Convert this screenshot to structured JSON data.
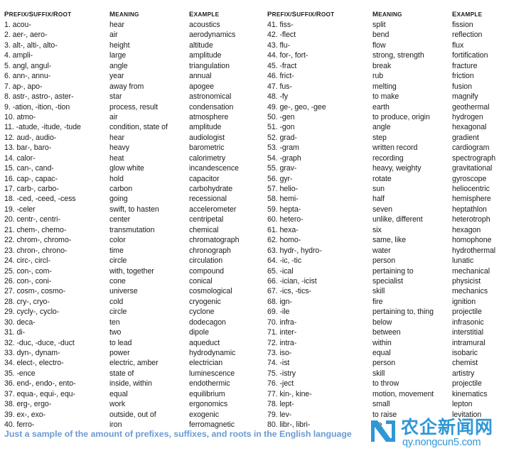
{
  "document": {
    "caption": "Just a sample of the amount of prefixes, suffixes, and roots in the English language",
    "caption_color": "#6b9bd2"
  },
  "columns": {
    "term": "Prefix/Suffix/Root",
    "meaning": "Meaning",
    "example": "Example"
  },
  "watermark": {
    "logo_text": "ND",
    "chinese_text": "农企新闻网",
    "url": "qy.nongcun5.com",
    "color": "#2f97d6"
  },
  "left_column": [
    {
      "n": "1.",
      "term": "acou-",
      "meaning": "hear",
      "example": "acoustics"
    },
    {
      "n": "2.",
      "term": "aer-, aero-",
      "meaning": "air",
      "example": "aerodynamics"
    },
    {
      "n": "3.",
      "term": "alt-, alti-, alto-",
      "meaning": "height",
      "example": "altitude"
    },
    {
      "n": "4.",
      "term": "ampli-",
      "meaning": "large",
      "example": "amplitude"
    },
    {
      "n": "5.",
      "term": "angl, angul-",
      "meaning": "angle",
      "example": "triangulation"
    },
    {
      "n": "6.",
      "term": "ann-, annu-",
      "meaning": "year",
      "example": "annual"
    },
    {
      "n": "7.",
      "term": "ap-, apo-",
      "meaning": "away from",
      "example": "apogee"
    },
    {
      "n": "8.",
      "term": "astr-, astro-, aster-",
      "meaning": "star",
      "example": "astronomical"
    },
    {
      "n": "9.",
      "term": "-ation, -ition, -tion",
      "meaning": "process, result",
      "example": "condensation"
    },
    {
      "n": "10.",
      "term": "atmo-",
      "meaning": "air",
      "example": "atmosphere"
    },
    {
      "n": "11.",
      "term": "-atude, -itude, -tude",
      "meaning": "condition, state of",
      "example": "amplitude"
    },
    {
      "n": "12.",
      "term": "aud-, audio-",
      "meaning": "hear",
      "example": "audiologist"
    },
    {
      "n": "13.",
      "term": "bar-, baro-",
      "meaning": "heavy",
      "example": "barometric"
    },
    {
      "n": "14.",
      "term": "calor-",
      "meaning": "heat",
      "example": "calorimetry"
    },
    {
      "n": "15.",
      "term": "can-, cand-",
      "meaning": "glow white",
      "example": "incandescence"
    },
    {
      "n": "16.",
      "term": "cap-, capac-",
      "meaning": "hold",
      "example": "capacitor"
    },
    {
      "n": "17.",
      "term": "carb-, carbo-",
      "meaning": "carbon",
      "example": "carbohydrate"
    },
    {
      "n": "18.",
      "term": "-ced, -ceed, -cess",
      "meaning": "going",
      "example": "recessional"
    },
    {
      "n": "19.",
      "term": "-celer",
      "meaning": "swift, to hasten",
      "example": "accelerometer"
    },
    {
      "n": "20.",
      "term": "centr-, centri-",
      "meaning": "center",
      "example": "centripetal"
    },
    {
      "n": "21.",
      "term": "chem-, chemo-",
      "meaning": "transmutation",
      "example": "chemical"
    },
    {
      "n": "22.",
      "term": "chrom-, chromo-",
      "meaning": "color",
      "example": "chromatograph"
    },
    {
      "n": "23.",
      "term": "chron-, chrono-",
      "meaning": "time",
      "example": "chronograph"
    },
    {
      "n": "24.",
      "term": "circ-, circl-",
      "meaning": "circle",
      "example": "circulation"
    },
    {
      "n": "25.",
      "term": "con-, com-",
      "meaning": "with, together",
      "example": "compound"
    },
    {
      "n": "26.",
      "term": "con-, coni-",
      "meaning": "cone",
      "example": "conical"
    },
    {
      "n": "27.",
      "term": "cosm-, cosmo-",
      "meaning": "universe",
      "example": "cosmological"
    },
    {
      "n": "28.",
      "term": "cry-, cryo-",
      "meaning": "cold",
      "example": "cryogenic"
    },
    {
      "n": "29.",
      "term": "cycly-, cyclo-",
      "meaning": "circle",
      "example": "cyclone"
    },
    {
      "n": "30.",
      "term": "deca-",
      "meaning": "ten",
      "example": "dodecagon"
    },
    {
      "n": "31.",
      "term": "di-",
      "meaning": "two",
      "example": "dipole"
    },
    {
      "n": "32.",
      "term": "-duc, -duce, -duct",
      "meaning": "to lead",
      "example": "aqueduct"
    },
    {
      "n": "33.",
      "term": "dyn-, dynam-",
      "meaning": "power",
      "example": "hydrodynamic"
    },
    {
      "n": "34.",
      "term": "elect-, electro-",
      "meaning": "electric, amber",
      "example": "electrician"
    },
    {
      "n": "35.",
      "term": "-ence",
      "meaning": "state of",
      "example": "luminescence"
    },
    {
      "n": "36.",
      "term": "end-, endo-, ento-",
      "meaning": "inside, within",
      "example": "endothermic"
    },
    {
      "n": "37.",
      "term": "equa-, equi-, equ-",
      "meaning": "equal",
      "example": "equilibrium"
    },
    {
      "n": "38.",
      "term": "erg-, ergo-",
      "meaning": "work",
      "example": "ergonomics"
    },
    {
      "n": "39.",
      "term": "ex-, exo-",
      "meaning": "outside, out of",
      "example": "exogenic"
    },
    {
      "n": "40.",
      "term": "ferro-",
      "meaning": "iron",
      "example": "ferromagnetic"
    }
  ],
  "right_column": [
    {
      "n": "41.",
      "term": "fiss-",
      "meaning": "split",
      "example": "fission"
    },
    {
      "n": "42.",
      "term": "-flect",
      "meaning": "bend",
      "example": "reflection"
    },
    {
      "n": "43.",
      "term": "flu-",
      "meaning": "flow",
      "example": "flux"
    },
    {
      "n": "44.",
      "term": "for-, fort-",
      "meaning": "strong, strength",
      "example": "fortification"
    },
    {
      "n": "45.",
      "term": "-fract",
      "meaning": "break",
      "example": "fracture"
    },
    {
      "n": "46.",
      "term": "frict-",
      "meaning": "rub",
      "example": "friction"
    },
    {
      "n": "47.",
      "term": "fus-",
      "meaning": "melting",
      "example": "fusion"
    },
    {
      "n": "48.",
      "term": "-fy",
      "meaning": "to make",
      "example": "magnify"
    },
    {
      "n": "49.",
      "term": "ge-, geo, -gee",
      "meaning": "earth",
      "example": "geothermal"
    },
    {
      "n": "50.",
      "term": "-gen",
      "meaning": "to produce, origin",
      "example": "hydrogen"
    },
    {
      "n": "51.",
      "term": "-gon",
      "meaning": "angle",
      "example": "hexagonal"
    },
    {
      "n": "52.",
      "term": "grad-",
      "meaning": "step",
      "example": "gradient"
    },
    {
      "n": "53.",
      "term": "-gram",
      "meaning": "written record",
      "example": "cardiogram"
    },
    {
      "n": "54.",
      "term": "-graph",
      "meaning": "recording",
      "example": "spectrograph"
    },
    {
      "n": "55.",
      "term": "grav-",
      "meaning": "heavy, weighty",
      "example": "gravitational"
    },
    {
      "n": "56.",
      "term": "gyr-",
      "meaning": "rotate",
      "example": "gyroscope"
    },
    {
      "n": "57.",
      "term": "helio-",
      "meaning": "sun",
      "example": "heliocentric"
    },
    {
      "n": "58.",
      "term": "hemi-",
      "meaning": "half",
      "example": "hemisphere"
    },
    {
      "n": "59.",
      "term": "hepta-",
      "meaning": "seven",
      "example": "heptathlon"
    },
    {
      "n": "60.",
      "term": "hetero-",
      "meaning": "unlike, different",
      "example": "heterotroph"
    },
    {
      "n": "61.",
      "term": "hexa-",
      "meaning": "six",
      "example": "hexagon"
    },
    {
      "n": "62.",
      "term": "homo-",
      "meaning": "same, like",
      "example": "homophone"
    },
    {
      "n": "63.",
      "term": "hydr-, hydro-",
      "meaning": "water",
      "example": "hydrothermal"
    },
    {
      "n": "64.",
      "term": "-ic, -tic",
      "meaning": "person",
      "example": "lunatic"
    },
    {
      "n": "65.",
      "term": "-ical",
      "meaning": "pertaining to",
      "example": "mechanical"
    },
    {
      "n": "66.",
      "term": "-ician, -icist",
      "meaning": "specialist",
      "example": "physicist"
    },
    {
      "n": "67.",
      "term": "-ics, -tics-",
      "meaning": "skill",
      "example": "mechanics"
    },
    {
      "n": "68.",
      "term": "ign-",
      "meaning": "fire",
      "example": "ignition"
    },
    {
      "n": "69.",
      "term": "-ile",
      "meaning": "pertaining to, thing",
      "example": "projectile"
    },
    {
      "n": "70.",
      "term": "infra-",
      "meaning": "below",
      "example": "infrasonic"
    },
    {
      "n": "71.",
      "term": "inter-",
      "meaning": "between",
      "example": "interstitial"
    },
    {
      "n": "72.",
      "term": "intra-",
      "meaning": "within",
      "example": "intramural"
    },
    {
      "n": "73.",
      "term": "iso-",
      "meaning": "equal",
      "example": "isobaric"
    },
    {
      "n": "74.",
      "term": "-ist",
      "meaning": "person",
      "example": "chemist"
    },
    {
      "n": "75.",
      "term": "-istry",
      "meaning": "skill",
      "example": "artistry"
    },
    {
      "n": "76.",
      "term": "-ject",
      "meaning": "to throw",
      "example": "projectile"
    },
    {
      "n": "77.",
      "term": "kin-, kine-",
      "meaning": "motion, movement",
      "example": "kinematics"
    },
    {
      "n": "78.",
      "term": "lept-",
      "meaning": "small",
      "example": "lepton"
    },
    {
      "n": "79.",
      "term": "lev-",
      "meaning": "to raise",
      "example": "levitation"
    },
    {
      "n": "80.",
      "term": "libr-, libri-",
      "meaning": "we",
      "example": ""
    }
  ]
}
